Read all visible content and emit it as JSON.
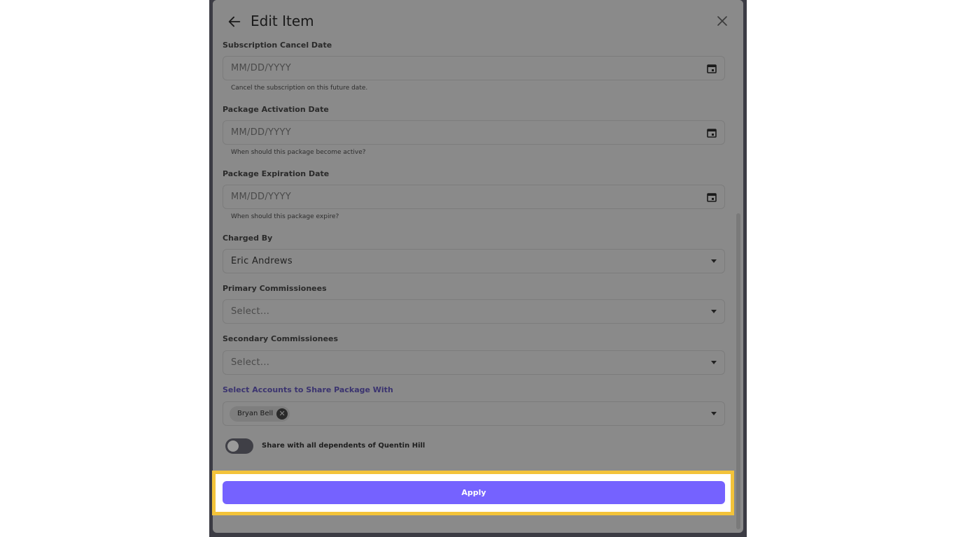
{
  "dialog": {
    "title": "Edit Item"
  },
  "fields": {
    "cancel_date": {
      "label": "Subscription Cancel Date",
      "placeholder": "MM/DD/YYYY",
      "helper": "Cancel the subscription on this future date."
    },
    "activation_date": {
      "label": "Package Activation Date",
      "placeholder": "MM/DD/YYYY",
      "helper": "When should this package become active?"
    },
    "expiration_date": {
      "label": "Package Expiration Date",
      "placeholder": "MM/DD/YYYY",
      "helper": "When should this package expire?"
    },
    "charged_by": {
      "label": "Charged By",
      "value": "Eric Andrews"
    },
    "primary_commissionees": {
      "label": "Primary Commissionees",
      "placeholder": "Select..."
    },
    "secondary_commissionees": {
      "label": "Secondary Commissionees",
      "placeholder": "Select..."
    },
    "share_accounts": {
      "label": "Select Accounts to Share Package With",
      "chips": [
        "Bryan Bell"
      ]
    }
  },
  "toggle": {
    "label": "Share with all dependents of Quentin Hill",
    "on": false
  },
  "actions": {
    "apply_label": "Apply"
  },
  "colors": {
    "accent": "#7562ff",
    "highlight": "#f3c33a"
  }
}
